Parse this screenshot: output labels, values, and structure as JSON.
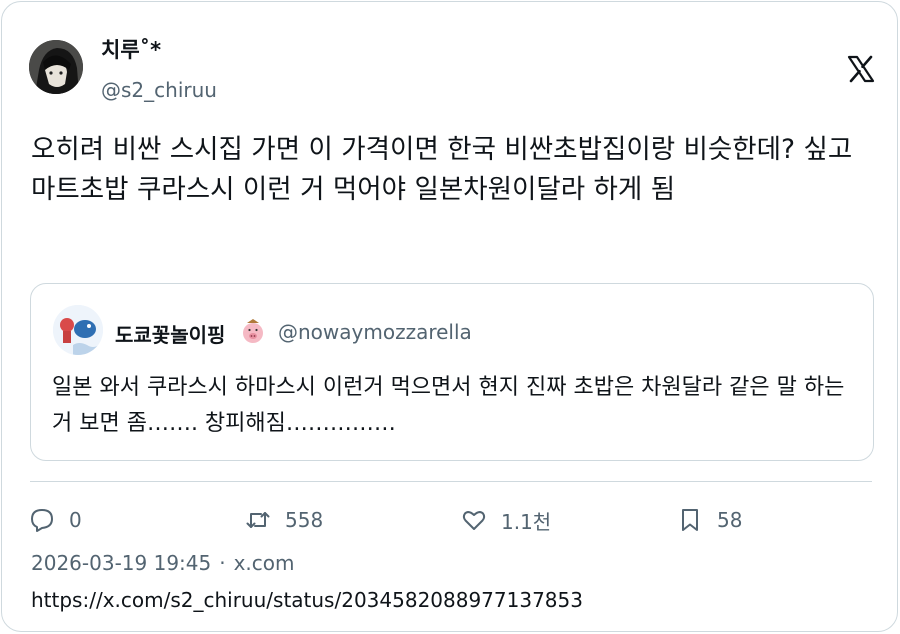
{
  "author": {
    "display_name": "치루˚*",
    "handle": "@s2_chiruu"
  },
  "tweet": {
    "text": "오히려 비싼 스시집 가면 이 가격이면 한국 비싼초밥집이랑 비슷한데? 싶고 마트초밥 쿠라스시 이런 거 먹어야 일본차원이달라 하게 됨"
  },
  "quoted": {
    "display_name": "도쿄꽃놀이핑",
    "handle": "@nowaymozzarella",
    "text": "일본 와서 쿠라스시 하마스시 이런거 먹으면서 현지 진짜 초밥은 차원달라 같은 말 하는거 보면 좀……. 창피해짐……………"
  },
  "actions": {
    "replies": "0",
    "retweets": "558",
    "likes": "1.1천",
    "bookmarks": "58"
  },
  "meta": {
    "datetime": "2026-03-19 19:45",
    "separator": "·",
    "source": "x.com",
    "url": "https://x.com/s2_chiruu/status/2034582088977137853"
  },
  "icons": [
    "x-logo-icon",
    "reply-icon",
    "retweet-icon",
    "like-icon",
    "bookmark-icon"
  ],
  "colors": {
    "text": "#0f1419",
    "secondary": "#536471",
    "border": "#cfd9de"
  }
}
